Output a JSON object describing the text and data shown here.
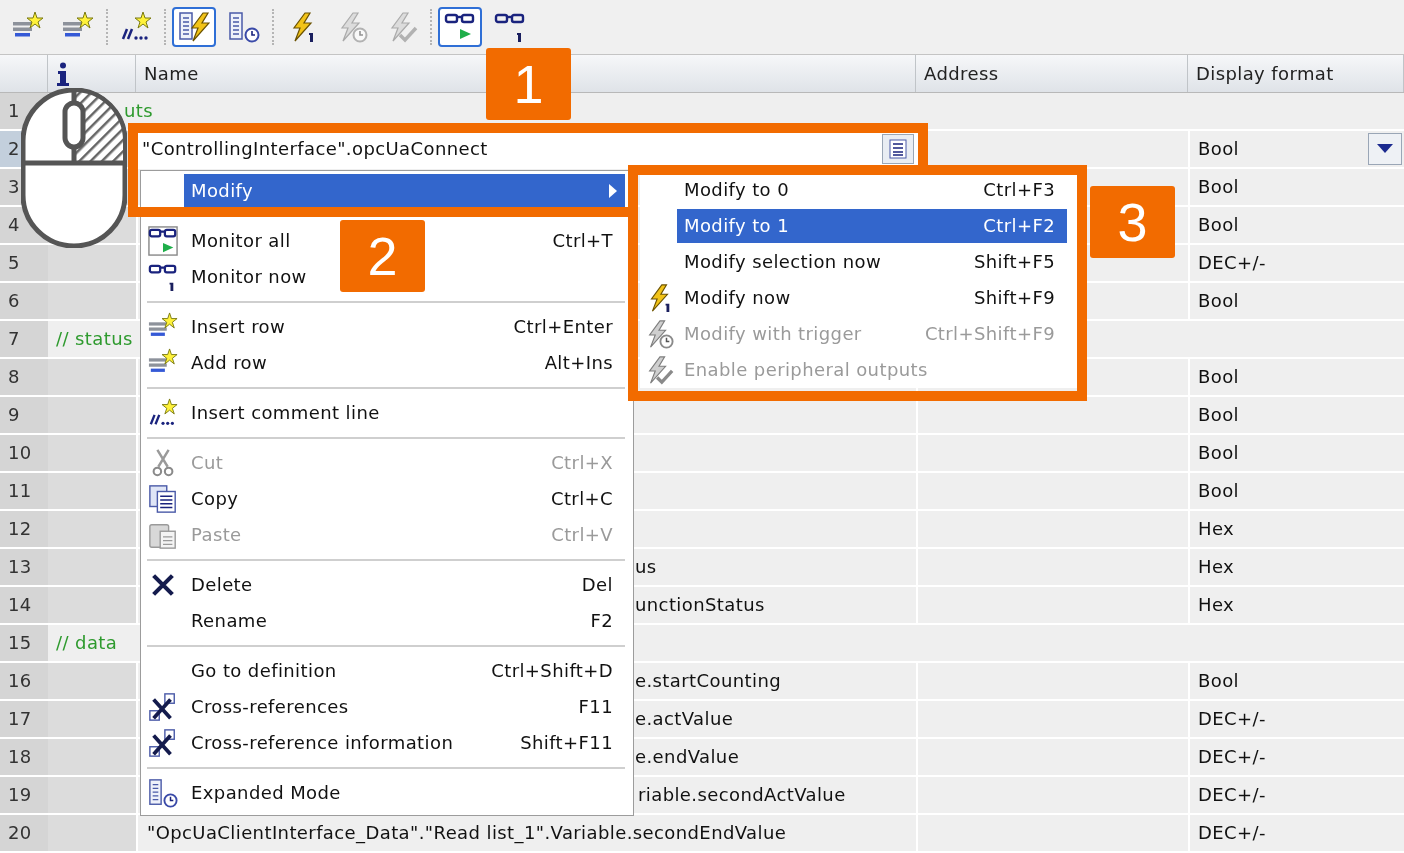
{
  "toolbar": [
    {
      "selected": false,
      "disabled": false
    },
    {
      "selected": false,
      "disabled": false
    },
    {
      "selected": false,
      "disabled": false
    },
    {
      "selected": true,
      "disabled": false
    },
    {
      "selected": false,
      "disabled": false
    },
    {
      "selected": false,
      "disabled": false
    },
    {
      "selected": false,
      "disabled": true
    },
    {
      "selected": false,
      "disabled": true
    },
    {
      "selected": true,
      "disabled": false
    },
    {
      "selected": false,
      "disabled": false
    }
  ],
  "table": {
    "columns": [
      "Name",
      "Address",
      "Display format"
    ],
    "rows": [
      {
        "number": "1",
        "kind": "comment",
        "name": "uts",
        "selected": false
      },
      {
        "number": "2",
        "kind": "editing",
        "name": "\"ControllingInterface\".opcUaConnect",
        "display_format": "Bool",
        "selected": true
      },
      {
        "number": "3",
        "kind": "variable",
        "display_format": "Bool",
        "selected": false
      },
      {
        "number": "4",
        "kind": "variable",
        "display_format": "Bool",
        "selected": false
      },
      {
        "number": "5",
        "kind": "variable",
        "display_format": "DEC+/-",
        "selected": false
      },
      {
        "number": "6",
        "kind": "variable",
        "display_format": "Bool",
        "selected": false
      },
      {
        "number": "7",
        "kind": "comment",
        "name": "// status",
        "selected": false
      },
      {
        "number": "8",
        "kind": "variable",
        "display_format": "Bool",
        "selected": false
      },
      {
        "number": "9",
        "kind": "variable",
        "display_format": "Bool",
        "selected": false
      },
      {
        "number": "10",
        "kind": "variable",
        "display_format": "Bool",
        "selected": false
      },
      {
        "number": "11",
        "kind": "variable",
        "display_format": "Bool",
        "selected": false
      },
      {
        "number": "12",
        "kind": "variable",
        "display_format": "Hex",
        "selected": false
      },
      {
        "number": "13",
        "kind": "variable",
        "name": "us",
        "display_format": "Hex",
        "selected": false
      },
      {
        "number": "14",
        "kind": "variable",
        "name": "unctionStatus",
        "display_format": "Hex",
        "selected": false
      },
      {
        "number": "15",
        "kind": "comment",
        "name": "// data",
        "selected": false
      },
      {
        "number": "16",
        "kind": "variable",
        "name": "e.startCounting",
        "display_format": "Bool",
        "selected": false
      },
      {
        "number": "17",
        "kind": "variable",
        "name": "e.actValue",
        "display_format": "DEC+/-",
        "selected": false
      },
      {
        "number": "18",
        "kind": "variable",
        "name": "e.endValue",
        "display_format": "DEC+/-",
        "selected": false
      },
      {
        "number": "19",
        "kind": "variable",
        "name": "riable.secondActValue",
        "display_format": "DEC+/-",
        "selected": false
      },
      {
        "number": "20",
        "kind": "variable",
        "name": "\"OpcUaClientInterface_Data\".\"Read list_1\".Variable.secondEndValue",
        "display_format": "DEC+/-",
        "selected": false
      }
    ]
  },
  "context_menu": {
    "groups": [
      [
        {
          "label": "Modify",
          "kind": "submenu",
          "selected": true,
          "disabled": false
        }
      ],
      [
        {
          "label": "Monitor all",
          "shortcut": "Ctrl+T",
          "kind": "command",
          "selected": false,
          "disabled": false
        },
        {
          "label": "Monitor now",
          "kind": "command",
          "selected": false,
          "disabled": false
        }
      ],
      [
        {
          "label": "Insert row",
          "shortcut": "Ctrl+Enter",
          "kind": "command",
          "selected": false,
          "disabled": false
        },
        {
          "label": "Add row",
          "shortcut": "Alt+Ins",
          "kind": "command",
          "selected": false,
          "disabled": false
        }
      ],
      [
        {
          "label": "Insert comment line",
          "kind": "command",
          "selected": false,
          "disabled": false
        }
      ],
      [
        {
          "label": "Cut",
          "shortcut": "Ctrl+X",
          "kind": "command",
          "selected": false,
          "disabled": true
        },
        {
          "label": "Copy",
          "shortcut": "Ctrl+C",
          "kind": "command",
          "selected": false,
          "disabled": false
        },
        {
          "label": "Paste",
          "shortcut": "Ctrl+V",
          "kind": "command",
          "selected": false,
          "disabled": true
        }
      ],
      [
        {
          "label": "Delete",
          "shortcut": "Del",
          "kind": "command",
          "selected": false,
          "disabled": false
        },
        {
          "label": "Rename",
          "shortcut": "F2",
          "kind": "command",
          "selected": false,
          "disabled": false
        }
      ],
      [
        {
          "label": "Go to definition",
          "shortcut": "Ctrl+Shift+D",
          "kind": "command",
          "selected": false,
          "disabled": false
        },
        {
          "label": "Cross-references",
          "shortcut": "F11",
          "kind": "command",
          "selected": false,
          "disabled": false
        },
        {
          "label": "Cross-reference information",
          "shortcut": "Shift+F11",
          "kind": "command",
          "selected": false,
          "disabled": false
        }
      ],
      [
        {
          "label": "Expanded Mode",
          "kind": "command",
          "selected": false,
          "disabled": false
        }
      ]
    ]
  },
  "submenu": {
    "items": [
      {
        "label": "Modify to 0",
        "shortcut": "Ctrl+F3",
        "selected": false,
        "disabled": false
      },
      {
        "label": "Modify to 1",
        "shortcut": "Ctrl+F2",
        "selected": true,
        "disabled": false
      },
      {
        "label": "Modify selection now",
        "shortcut": "Shift+F5",
        "selected": false,
        "disabled": false
      },
      {
        "label": "Modify now",
        "shortcut": "Shift+F9",
        "selected": false,
        "disabled": false
      },
      {
        "label": "Modify with trigger",
        "shortcut": "Ctrl+Shift+F9",
        "selected": false,
        "disabled": true
      },
      {
        "label": "Enable peripheral outputs",
        "selected": false,
        "disabled": true
      }
    ]
  },
  "callouts": [
    {
      "label": "1"
    },
    {
      "label": "2"
    },
    {
      "label": "3"
    }
  ]
}
